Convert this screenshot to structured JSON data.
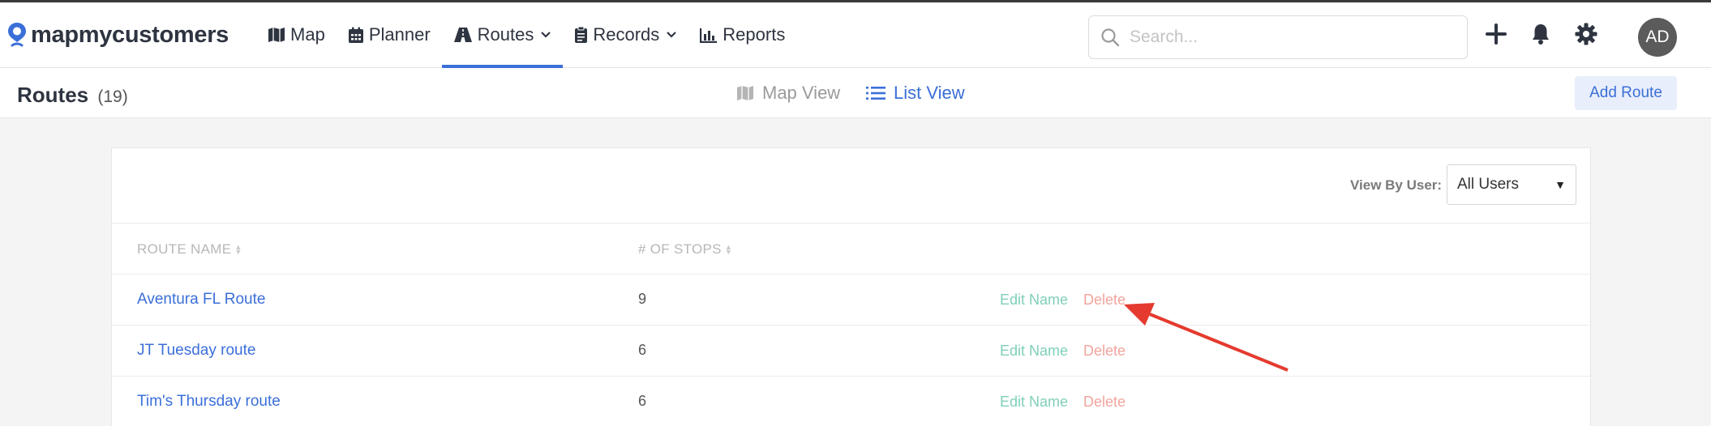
{
  "brand": {
    "name": "mapmycustomers",
    "accent": "#3b6fd8"
  },
  "nav": {
    "items": [
      {
        "label": "Map",
        "icon": "map-icon"
      },
      {
        "label": "Planner",
        "icon": "calendar-icon"
      },
      {
        "label": "Routes",
        "icon": "route-icon",
        "active": true,
        "dropdown": true
      },
      {
        "label": "Records",
        "icon": "clipboard-icon",
        "dropdown": true
      },
      {
        "label": "Reports",
        "icon": "bar-chart-icon"
      }
    ],
    "search_placeholder": "Search...",
    "avatar_initials": "AD"
  },
  "subheader": {
    "title": "Routes",
    "count": "(19)",
    "map_view_label": "Map View",
    "list_view_label": "List View",
    "active_view": "List View",
    "add_button_label": "Add Route"
  },
  "filter": {
    "label": "View By User:",
    "selected": "All Users"
  },
  "table": {
    "columns": [
      "ROUTE NAME",
      "# OF STOPS"
    ],
    "rows": [
      {
        "name": "Aventura FL Route",
        "stops": "9",
        "edit": "Edit Name",
        "delete": "Delete"
      },
      {
        "name": "JT Tuesday route",
        "stops": "6",
        "edit": "Edit Name",
        "delete": "Delete"
      },
      {
        "name": "Tim's Thursday route",
        "stops": "6",
        "edit": "Edit Name",
        "delete": "Delete"
      }
    ]
  },
  "colors": {
    "edit_link": "#7fcfba",
    "delete_link": "#f2a49c",
    "annotation_arrow": "#e53a2f"
  }
}
